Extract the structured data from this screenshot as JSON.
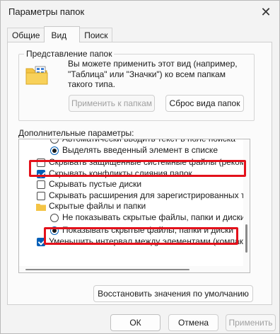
{
  "window": {
    "title": "Параметры папок",
    "close_glyph": "✕"
  },
  "tabs": [
    {
      "label": "Общие"
    },
    {
      "label": "Вид"
    },
    {
      "label": "Поиск"
    }
  ],
  "folder_views": {
    "legend": "Представление папок",
    "description": "Вы можете применить этот вид (например, \"Таблица\" или \"Значки\") ко всем папкам такого типа.",
    "apply_label": "Применить к папкам",
    "reset_label": "Сброс вида папок"
  },
  "advanced": {
    "label": "Дополнительные параметры:",
    "items": [
      {
        "type": "radio",
        "checked": false,
        "text": "Автоматически вводить текст в поле поиска"
      },
      {
        "type": "radio",
        "checked": true,
        "text": "Выделять введенный элемент в списке"
      },
      {
        "type": "checkbox",
        "checked": false,
        "text": "Скрывать защищенные системные файлы (рекомен"
      },
      {
        "type": "checkbox",
        "checked": true,
        "text": "Скрывать конфликты слияния папок"
      },
      {
        "type": "checkbox",
        "checked": false,
        "text": "Скрывать пустые диски"
      },
      {
        "type": "checkbox",
        "checked": false,
        "text": "Скрывать расширения для зарегистрированных типо"
      },
      {
        "type": "folder",
        "checked": false,
        "text": "Скрытые файлы и папки"
      },
      {
        "type": "radio",
        "checked": false,
        "text": "Не показывать скрытые файлы, папки и диски"
      },
      {
        "type": "radio",
        "checked": true,
        "text": "Показывать скрытые файлы, папки и диски"
      },
      {
        "type": "checkbox",
        "checked": true,
        "text": "Уменьшить интервал между элементами (компактн"
      }
    ],
    "restore_label": "Восстановить значения по умолчанию"
  },
  "footer": {
    "ok_label": "ОК",
    "cancel_label": "Отмена",
    "apply_label": "Применить"
  },
  "colors": {
    "accent": "#005fb8",
    "highlight": "#e3111b",
    "folder": "#f4c445"
  }
}
